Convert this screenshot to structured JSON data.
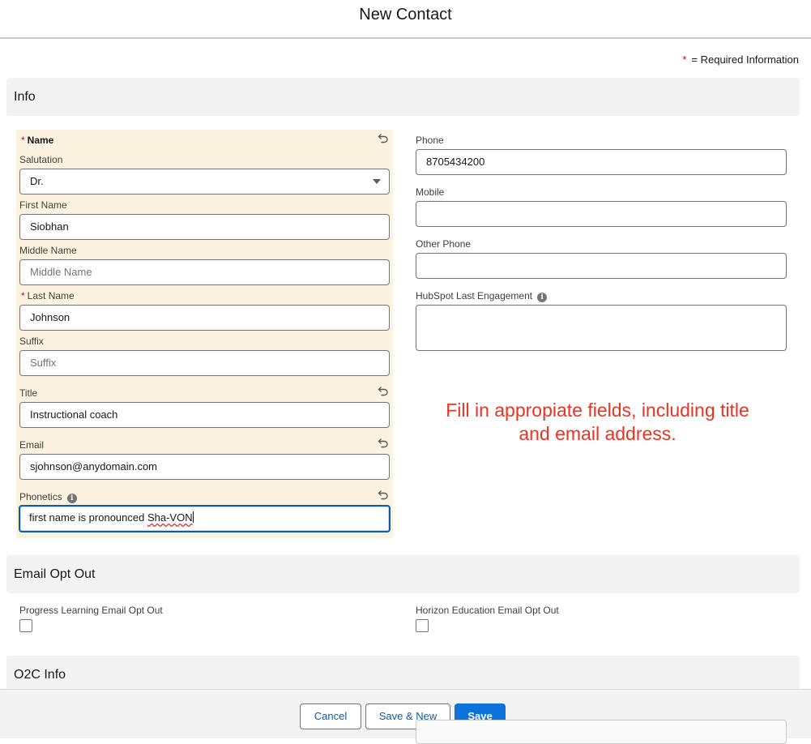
{
  "header": {
    "title": "New Contact"
  },
  "required_note": {
    "star": "*",
    "text": "= Required Information"
  },
  "sections": {
    "info": "Info",
    "email_opt_out": "Email Opt Out",
    "o2c_info": "O2C Info"
  },
  "name_group": {
    "label_star": "*",
    "label": "Name",
    "salutation": {
      "label": "Salutation",
      "value": "Dr."
    },
    "first_name": {
      "label": "First Name",
      "value": "Siobhan"
    },
    "middle_name": {
      "label": "Middle Name",
      "placeholder": "Middle Name"
    },
    "last_name": {
      "label_star": "*",
      "label": "Last Name",
      "value": "Johnson"
    },
    "suffix": {
      "label": "Suffix",
      "placeholder": "Suffix"
    }
  },
  "title_field": {
    "label": "Title",
    "value": "Instructional coach"
  },
  "email_field": {
    "label": "Email",
    "value": "sjohnson@anydomain.com"
  },
  "phonetics_field": {
    "label": "Phonetics",
    "value_prefix": "first name is pronounced ",
    "value_misspelled": "Sha-VON"
  },
  "phone_field": {
    "label": "Phone",
    "value": "8705434200"
  },
  "mobile_field": {
    "label": "Mobile",
    "value": ""
  },
  "other_phone_field": {
    "label": "Other Phone",
    "value": ""
  },
  "hubspot_field": {
    "label": "HubSpot Last Engagement",
    "value": ""
  },
  "annotation": {
    "line1": "Fill in appropiate fields, including title",
    "line2": "and email address."
  },
  "opt_out": {
    "progress_learning": {
      "label": "Progress Learning Email Opt Out",
      "checked": false
    },
    "horizon_education": {
      "label": "Horizon Education Email Opt Out",
      "checked": false
    }
  },
  "footer": {
    "cancel": "Cancel",
    "save_new": "Save & New",
    "save": "Save"
  },
  "icons": {
    "undo": "undo-icon",
    "info": "info-icon",
    "caret": "chevron-down-icon"
  },
  "colors": {
    "brand": "#0b73d9",
    "required": "#ba0517",
    "highlight": "#fbf3e0",
    "annotation": "#ea3323"
  }
}
